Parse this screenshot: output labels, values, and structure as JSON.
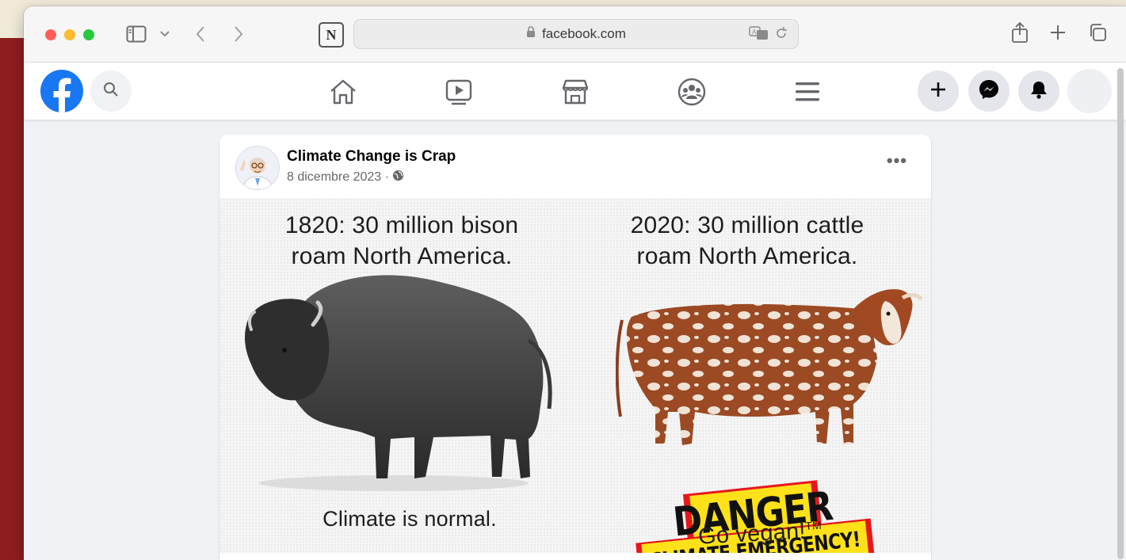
{
  "browser": {
    "url": "facebook.com",
    "icons": [
      "traffic-lights",
      "sidebar-icon",
      "chevron-down-icon",
      "back-icon",
      "forward-icon",
      "notion-icon",
      "lock-icon",
      "translate-icon",
      "reload-icon",
      "share-icon",
      "new-tab-icon",
      "tabs-overview-icon"
    ],
    "notion_letter": "N"
  },
  "facebook": {
    "nav_icons": [
      "home-icon",
      "video-icon",
      "marketplace-icon",
      "groups-icon",
      "menu-icon"
    ],
    "right_buttons": [
      "create-icon",
      "messenger-icon",
      "notifications-icon",
      "account-avatar"
    ],
    "brand_color": "#1877f2"
  },
  "post": {
    "author": "Climate Change is Crap",
    "date": "8 dicembre 2023 ·",
    "privacy_icon": "globe-icon",
    "more_label": "•••",
    "image": {
      "left_caption_line1": "1820: 30 million bison",
      "left_caption_line2": "roam North America.",
      "right_caption_line1": "2020: 30 million cattle",
      "right_caption_line2": "roam North America.",
      "left_footer": "Climate is normal.",
      "danger": "DANGER",
      "emergency": "CLIMATE EMERGENCY!",
      "right_footer": "Go vegan!",
      "trademark": "TM"
    }
  }
}
